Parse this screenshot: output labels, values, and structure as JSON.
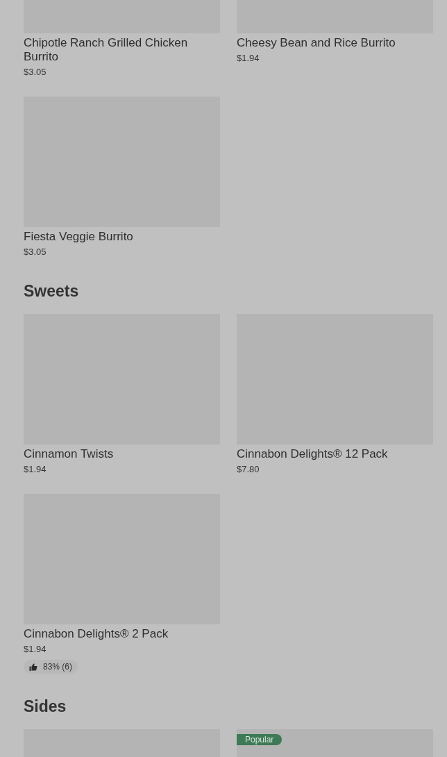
{
  "sections": [
    {
      "items": [
        {
          "name": "Chipotle Ranch Grilled Chicken Burrito",
          "price": "$3.05"
        },
        {
          "name": "Cheesy Bean and Rice Burrito",
          "price": "$1.94"
        },
        {
          "name": "Fiesta Veggie Burrito",
          "price": "$3.05"
        }
      ]
    },
    {
      "title": "Sweets",
      "items": [
        {
          "name": "Cinnamon Twists",
          "price": "$1.94"
        },
        {
          "name": "Cinnabon Delights® 12 Pack",
          "price": "$7.80"
        },
        {
          "name": "Cinnabon Delights® 2 Pack",
          "price": "$1.94",
          "rating": "83% (6)"
        }
      ]
    },
    {
      "title": "Sides",
      "items": [
        {
          "kind": "image"
        },
        {
          "kind": "image",
          "badge": "Popular"
        }
      ]
    }
  ]
}
